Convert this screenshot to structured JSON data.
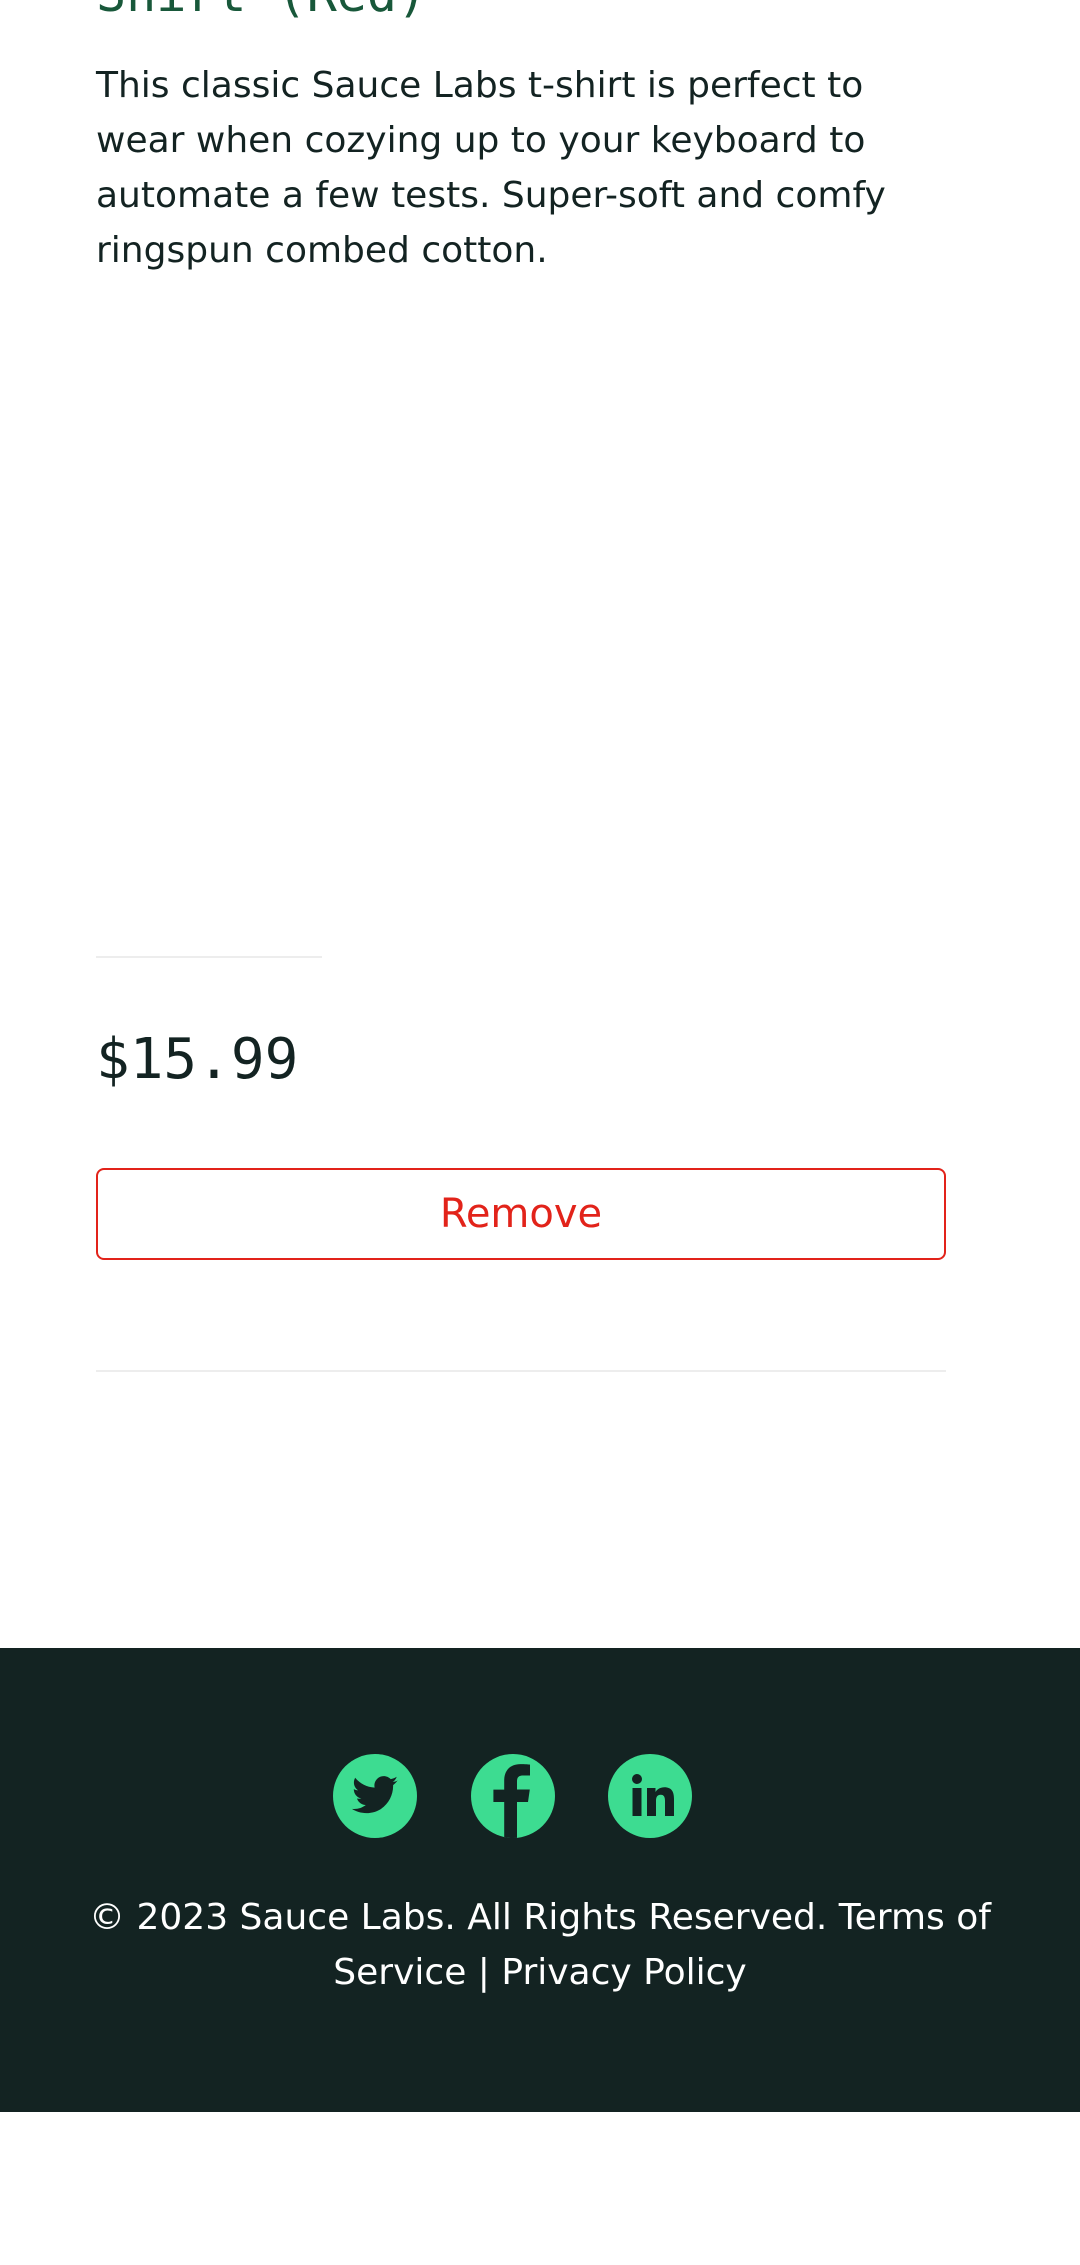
{
  "product": {
    "title": "Shirt (Red)",
    "description": "This classic Sauce Labs t-shirt is perfect to wear when cozying up to your keyboard to automate a few tests. Super-soft and comfy ringspun combed cotton.",
    "price": "$15.99",
    "remove_label": "Remove"
  },
  "footer": {
    "social": [
      {
        "name": "twitter",
        "icon": "twitter-icon"
      },
      {
        "name": "facebook",
        "icon": "facebook-icon"
      },
      {
        "name": "linkedin",
        "icon": "linkedin-icon"
      }
    ],
    "copyright": "© 2023 Sauce Labs. All Rights Reserved. Terms of Service | Privacy Policy"
  },
  "colors": {
    "title": "#18583a",
    "text": "#132322",
    "remove": "#e2231a",
    "footer_bg": "#132322",
    "social_icon_bg": "#3ddc91"
  }
}
